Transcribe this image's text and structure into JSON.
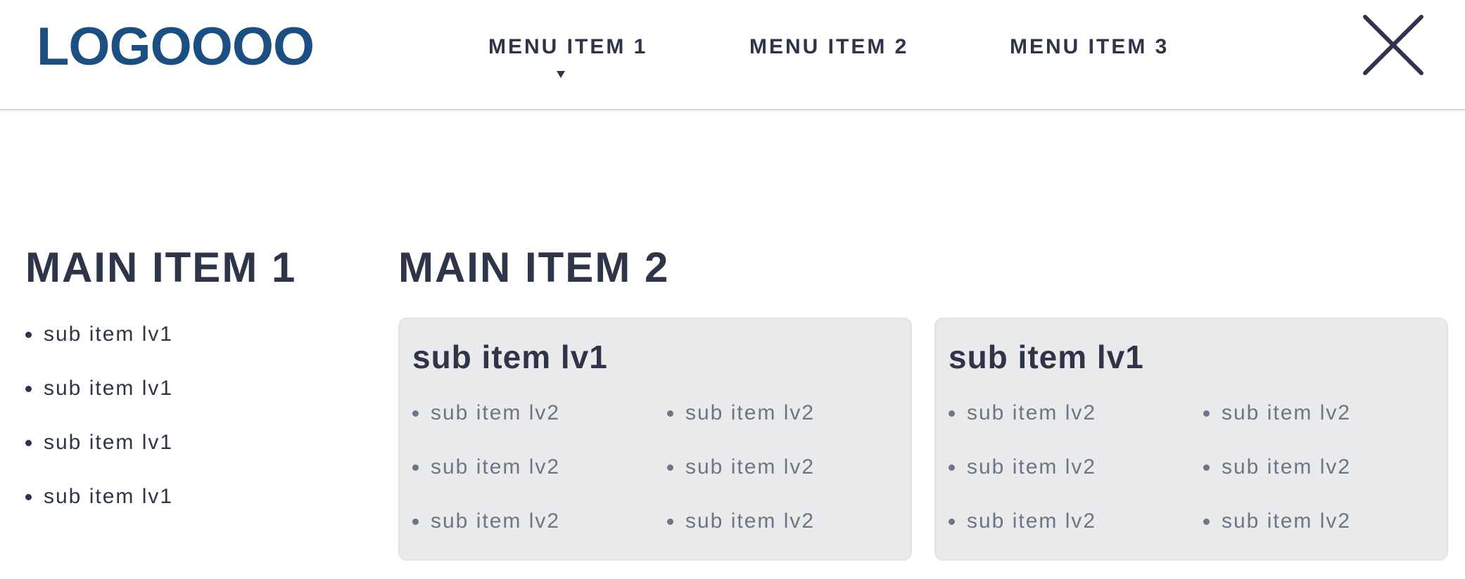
{
  "header": {
    "logo": "LOGOOOO",
    "menu": [
      {
        "label": "MENU ITEM 1",
        "expanded": true
      },
      {
        "label": "MENU ITEM 2"
      },
      {
        "label": "MENU ITEM 3"
      }
    ],
    "close_icon": "close-icon"
  },
  "colors": {
    "brand": "#1b4f82",
    "text": "#2e3548",
    "muted_text": "#6f7485",
    "card_bg": "#e9eaec"
  },
  "main": {
    "col1": {
      "title": "MAIN ITEM 1",
      "items": [
        "sub item lv1",
        "sub item lv1",
        "sub item lv1",
        "sub item lv1"
      ]
    },
    "col2": {
      "title": "MAIN ITEM 2",
      "cards": [
        {
          "title": "sub item lv1",
          "items": [
            "sub item lv2",
            "sub item lv2",
            "sub item lv2",
            "sub item lv2",
            "sub item lv2",
            "sub item lv2"
          ]
        },
        {
          "title": "sub item lv1",
          "items": [
            "sub item lv2",
            "sub item lv2",
            "sub item lv2",
            "sub item lv2",
            "sub item lv2",
            "sub item lv2"
          ]
        }
      ]
    }
  }
}
